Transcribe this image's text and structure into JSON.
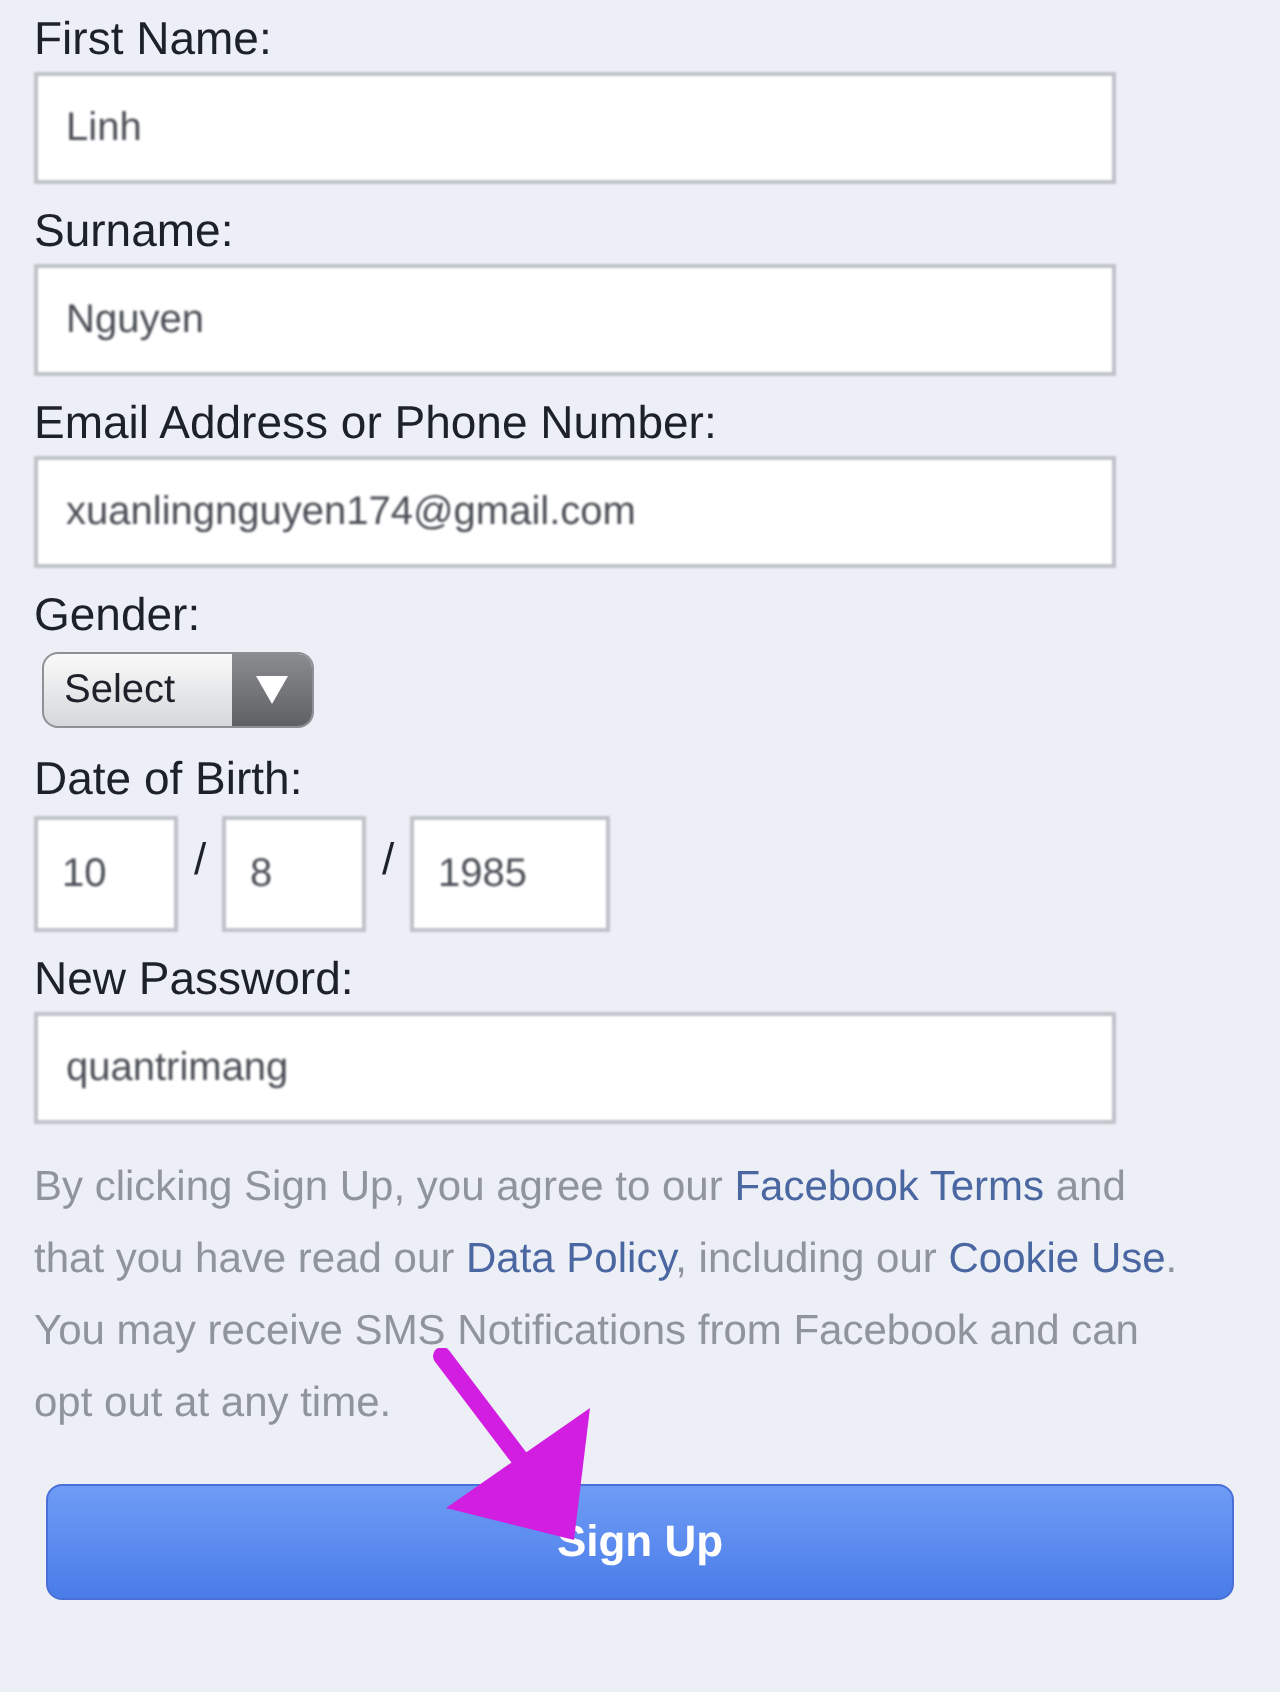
{
  "fields": [
    {
      "label": "First Name:",
      "kind": "text",
      "value": "Linh"
    },
    {
      "label": "Surname:",
      "kind": "text",
      "value": "Nguyen"
    },
    {
      "label": "Email Address or Phone Number:",
      "kind": "text",
      "value": "xuanlingnguyen174@gmail.com"
    },
    {
      "label": "Gender:",
      "kind": "select",
      "value": "Select"
    },
    {
      "label": "Date of Birth:",
      "kind": "date",
      "parts": [
        "10",
        "8",
        "1985"
      ],
      "separator": "/"
    },
    {
      "label": "New Password:",
      "kind": "text",
      "value": "quantrimang"
    }
  ],
  "terms": [
    {
      "kind": "text",
      "text": "By clicking Sign Up, you agree to our "
    },
    {
      "kind": "link",
      "text": "Facebook Terms"
    },
    {
      "kind": "text",
      "text": " and that you have read our "
    },
    {
      "kind": "link",
      "text": "Data Policy"
    },
    {
      "kind": "text",
      "text": ", including our "
    },
    {
      "kind": "link",
      "text": "Cookie Use"
    },
    {
      "kind": "text",
      "text": ". You may receive SMS Notifications from Facebook and can opt out at any time."
    }
  ],
  "submit": {
    "label": "Sign Up"
  }
}
